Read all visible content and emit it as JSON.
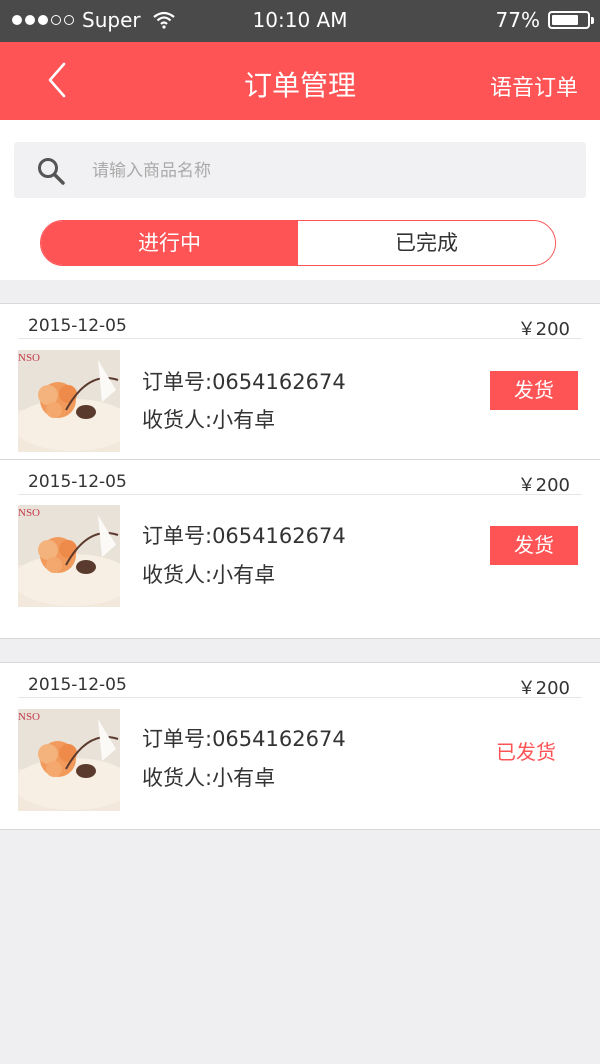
{
  "status_bar": {
    "carrier": "Super",
    "time": "10:10 AM",
    "battery": "77%",
    "battery_level": 0.77
  },
  "nav": {
    "title": "订单管理",
    "right_label": "语音订单",
    "back_icon": "chevron-left-icon",
    "color": "#ff5456"
  },
  "search": {
    "placeholder": "请输入商品名称",
    "value": ""
  },
  "tabs": {
    "active": "进行中",
    "inactive": "已完成"
  },
  "orders": [
    {
      "date": "2015-12-05",
      "price": "￥200",
      "order_no": "订单号:0654162674",
      "receiver": "收货人:小有卓",
      "action": "发货"
    },
    {
      "date": "2015-12-05",
      "price": "￥200",
      "order_no": "订单号:0654162674",
      "receiver": "收货人:小有卓",
      "action": "发货"
    },
    {
      "date": "2015-12-05",
      "price": "￥200",
      "order_no": "订单号:0654162674",
      "receiver": "收货人:小有卓",
      "status": "已发货"
    }
  ],
  "thumbnail_text": "NSO"
}
